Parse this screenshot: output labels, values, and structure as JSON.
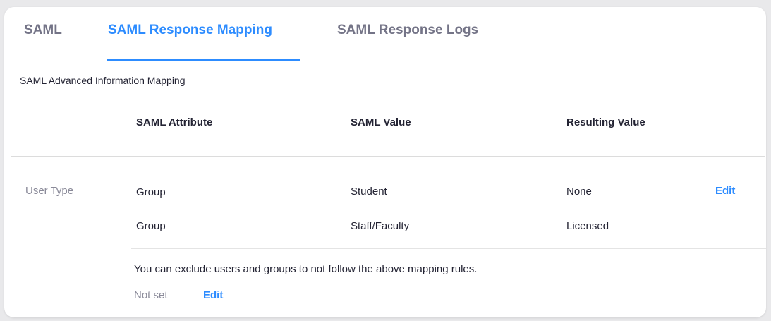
{
  "tabs": [
    {
      "label": "SAML"
    },
    {
      "label": "SAML Response Mapping"
    },
    {
      "label": "SAML Response Logs"
    }
  ],
  "section_title": "SAML Advanced Information Mapping",
  "table": {
    "headers": [
      "SAML Attribute",
      "SAML Value",
      "Resulting Value"
    ],
    "row_label": "User Type",
    "rows": [
      {
        "attribute": "Group",
        "value": "Student",
        "result": "None",
        "action": "Edit"
      },
      {
        "attribute": "Group",
        "value": "Staff/Faculty",
        "result": "Licensed"
      }
    ]
  },
  "exclusion": {
    "note": "You can exclude users and groups to not follow the above mapping rules.",
    "status": "Not set",
    "action": "Edit"
  },
  "colors": {
    "accent": "#2d8cff",
    "text": "#232333",
    "muted": "#8a8a99"
  }
}
